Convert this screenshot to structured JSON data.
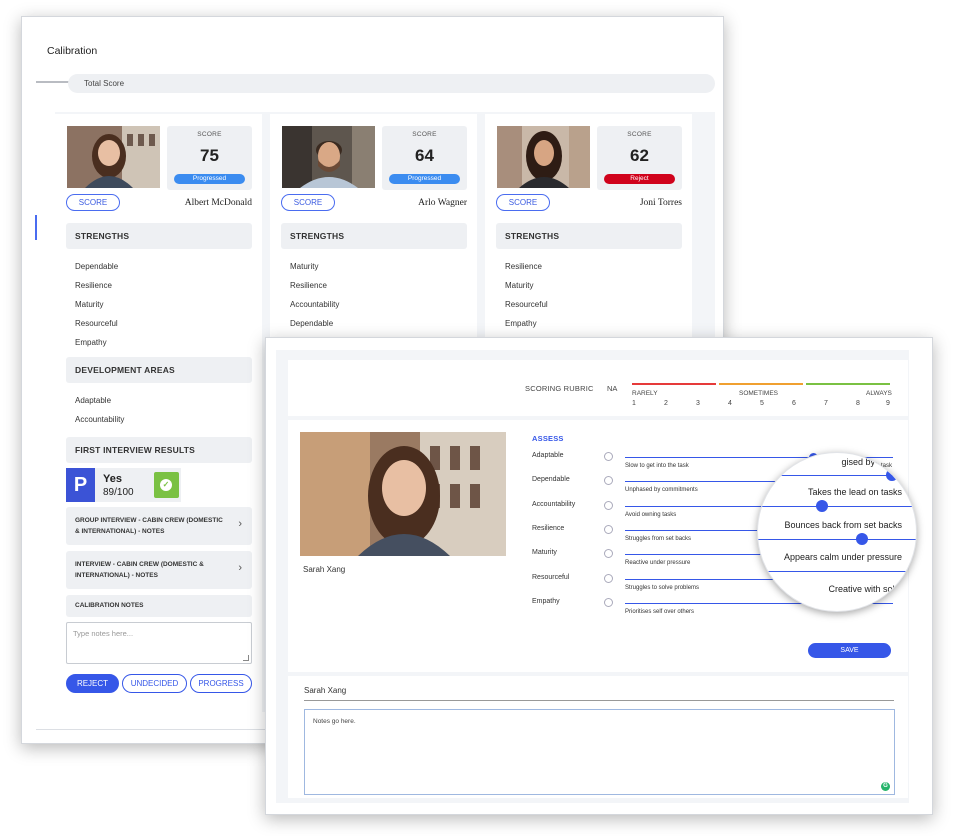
{
  "calibration": {
    "title": "Calibration",
    "total_score_label": "Total Score"
  },
  "candidates": [
    {
      "name": "Albert McDonald",
      "score_label": "SCORE",
      "score": "75",
      "status": "Progressed",
      "status_color": "#3b8cf0",
      "button_label": "SCORE",
      "strengths_title": "STRENGTHS",
      "strengths": [
        "Dependable",
        "Resilience",
        "Maturity",
        "Resourceful",
        "Empathy"
      ],
      "development_title": "DEVELOPMENT AREAS",
      "development": [
        "Adaptable",
        "Accountability"
      ],
      "first_interview_title": "FIRST INTERVIEW RESULTS",
      "first_interview_result": "Yes",
      "first_interview_score": "89/100",
      "note_group": "GROUP INTERVIEW - CABIN CREW (DOMESTIC & INTERNATIONAL) - NOTES",
      "note_interview": "INTERVIEW - CABIN CREW (DOMESTIC & INTERNATIONAL) - NOTES",
      "calibration_notes_title": "CALIBRATION NOTES",
      "notes_placeholder": "Type notes here...",
      "actions": {
        "reject": "REJECT",
        "undecided": "UNDECIDED",
        "progress": "PROGRESS"
      }
    },
    {
      "name": "Arlo Wagner",
      "score_label": "SCORE",
      "score": "64",
      "status": "Progressed",
      "status_color": "#3b8cf0",
      "button_label": "SCORE",
      "strengths_title": "STRENGTHS",
      "strengths": [
        "Maturity",
        "Resilience",
        "Accountability",
        "Dependable"
      ]
    },
    {
      "name": "Joni Torres",
      "score_label": "SCORE",
      "score": "62",
      "status": "Reject",
      "status_color": "#d0021b",
      "button_label": "SCORE",
      "strengths_title": "STRENGTHS",
      "strengths": [
        "Resilience",
        "Maturity",
        "Resourceful",
        "Empathy"
      ]
    }
  ],
  "rubric": {
    "label": "SCORING RUBRIC",
    "na": "NA",
    "bands": [
      {
        "word": "RARELY",
        "color": "#e63a3a"
      },
      {
        "word": "SOMETIMES",
        "color": "#f0a030"
      },
      {
        "word": "ALWAYS",
        "color": "#7ac143"
      }
    ],
    "numbers": [
      "1",
      "2",
      "3",
      "4",
      "5",
      "6",
      "7",
      "8",
      "9"
    ]
  },
  "assess": {
    "title": "ASSESS",
    "candidate_name": "Sarah Xang",
    "rows": [
      {
        "label": "Adaptable",
        "low": "Slow to get into the task",
        "high": "Quickly gets on with task",
        "value": 6.6
      },
      {
        "label": "Dependable",
        "low": "Unphased by commitments",
        "high": "",
        "value": 8.2
      },
      {
        "label": "Accountability",
        "low": "Avoid owning tasks",
        "high": "",
        "value": 9
      },
      {
        "label": "Resilience",
        "low": "Struggles from set backs",
        "high": "",
        "value": 7
      },
      {
        "label": "Maturity",
        "low": "Reactive under pressure",
        "high": "",
        "value": 7
      },
      {
        "label": "Resourceful",
        "low": "Struggles to solve problems",
        "high": "",
        "value": 8
      },
      {
        "label": "Empathy",
        "low": "Prioritises self over others",
        "high": "",
        "value": 8
      }
    ],
    "save_label": "SAVE",
    "magnifier": {
      "line1": "gised by comm",
      "line2": "Takes the lead on tasks",
      "line3": "Bounces back from set backs",
      "line4": "Appears calm under pressure",
      "line5": "Creative with solut"
    }
  },
  "notes": {
    "name": "Sarah Xang",
    "text": "Notes go here."
  },
  "colors": {
    "accent": "#3657e8",
    "panel_bg": "#f3f5f8"
  }
}
